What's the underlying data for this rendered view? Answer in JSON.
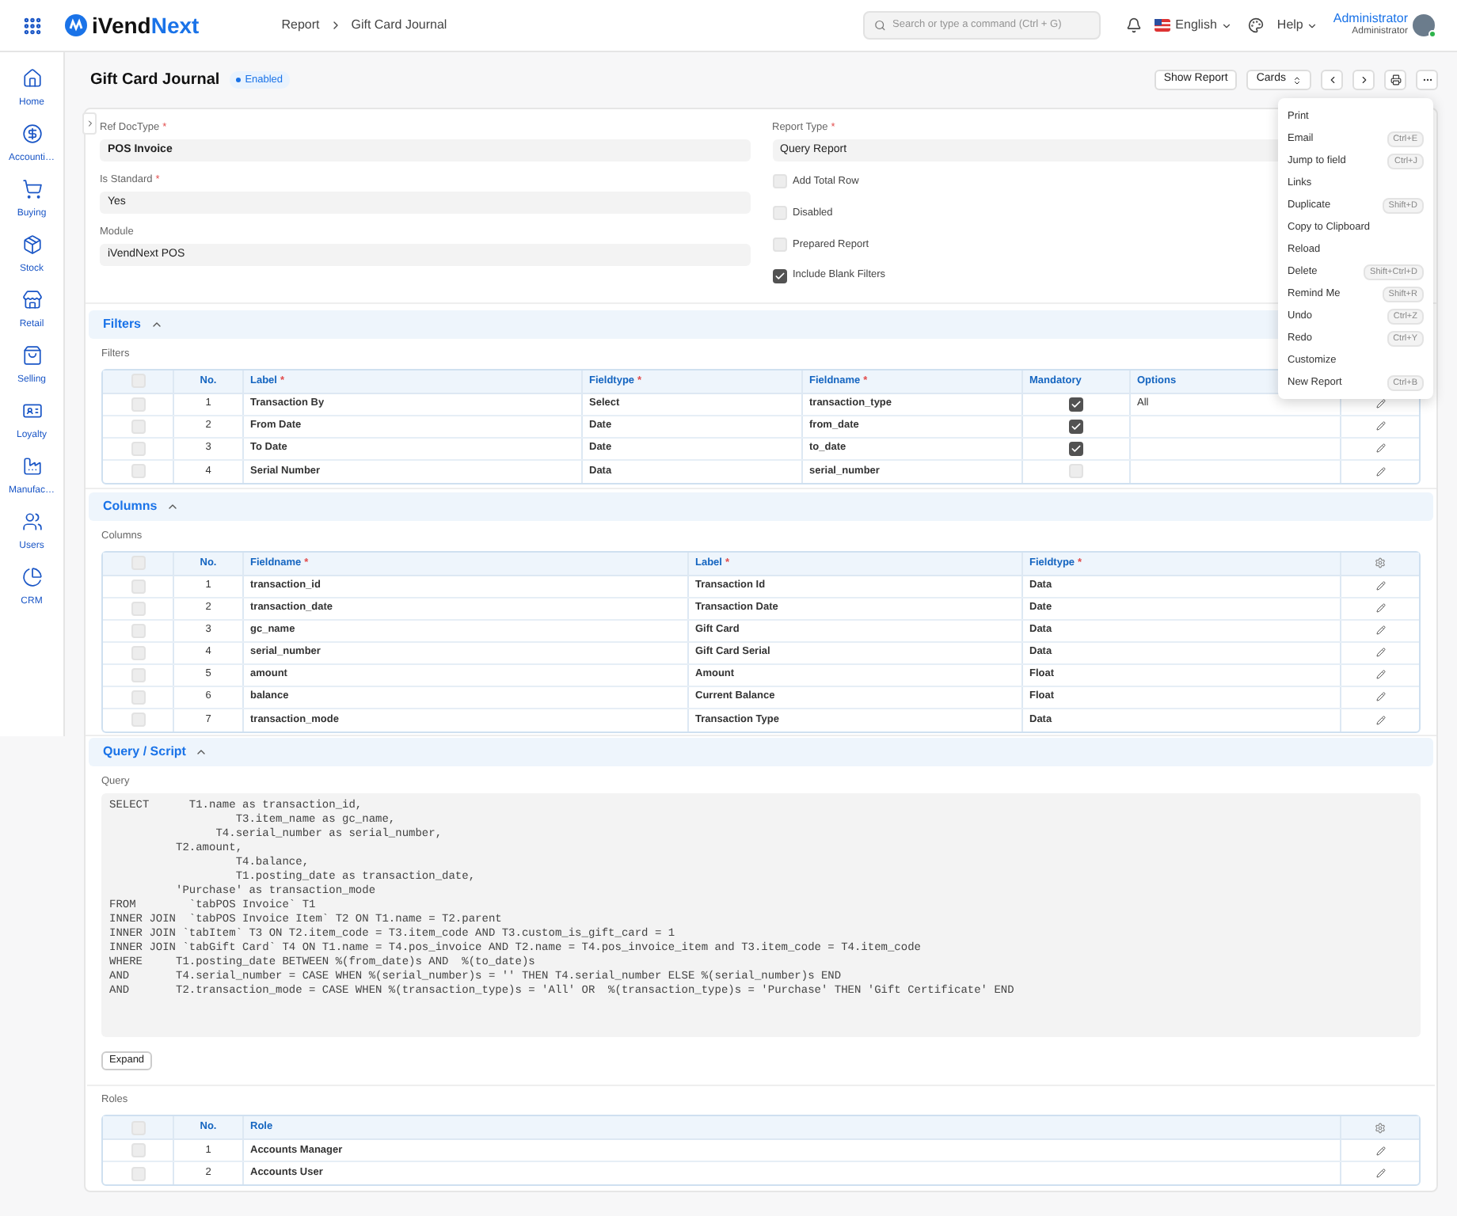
{
  "topbar": {
    "logo_a": "iVend",
    "logo_b": "Next",
    "breadcrumbs": [
      "Report",
      "Gift Card Journal"
    ],
    "search": {
      "placeholder": "Search or type a command (Ctrl + G)"
    },
    "language": "English",
    "help": "Help",
    "user": {
      "name": "Administrator",
      "role": "Administrator"
    }
  },
  "sidebar": {
    "items": [
      {
        "kind": "home",
        "label": "Home"
      },
      {
        "kind": "accounting",
        "label": "Accounti…"
      },
      {
        "kind": "buying",
        "label": "Buying"
      },
      {
        "kind": "stock",
        "label": "Stock"
      },
      {
        "kind": "retail",
        "label": "Retail"
      },
      {
        "kind": "selling",
        "label": "Selling"
      },
      {
        "kind": "loyalty",
        "label": "Loyalty"
      },
      {
        "kind": "manufacturing",
        "label": "Manufac…"
      },
      {
        "kind": "users",
        "label": "Users"
      },
      {
        "kind": "crm",
        "label": "CRM"
      }
    ]
  },
  "page": {
    "title": "Gift Card Journal",
    "status": "Enabled",
    "buttons": {
      "show_report": "Show Report",
      "view": "Cards"
    }
  },
  "menu": {
    "items": [
      {
        "label": "Print"
      },
      {
        "label": "Email",
        "shortcut": "Ctrl+E"
      },
      {
        "label": "Jump to field",
        "shortcut": "Ctrl+J"
      },
      {
        "label": "Links"
      },
      {
        "label": "Duplicate",
        "shortcut": "Shift+D"
      },
      {
        "label": "Copy to Clipboard"
      },
      {
        "label": "Reload"
      },
      {
        "label": "Delete",
        "shortcut": "Shift+Ctrl+D"
      },
      {
        "label": "Remind Me",
        "shortcut": "Shift+R"
      },
      {
        "label": "Undo",
        "shortcut": "Ctrl+Z"
      },
      {
        "label": "Redo",
        "shortcut": "Ctrl+Y"
      },
      {
        "label": "Customize"
      },
      {
        "label": "New Report",
        "shortcut": "Ctrl+B"
      }
    ]
  },
  "form": {
    "left_fields": [
      {
        "label": "Ref DocType",
        "required_mark": "*",
        "value": "POS Invoice",
        "bold": true
      },
      {
        "label": "Is Standard",
        "required_mark": "*",
        "value": "Yes",
        "bold": false
      },
      {
        "label": "Module",
        "value": "iVendNext POS",
        "bold": false
      }
    ],
    "report_type": {
      "label": "Report Type",
      "required_mark": "*",
      "value": "Query Report"
    },
    "checkboxes": [
      {
        "label": "Add Total Row",
        "checked": false
      },
      {
        "label": "Disabled",
        "checked": false
      },
      {
        "label": "Prepared Report",
        "checked": false
      },
      {
        "label": "Include Blank Filters",
        "checked": true
      }
    ]
  },
  "filters": {
    "title": "Filters",
    "expanded": true,
    "table_label": "Filters",
    "all_selected": false,
    "columns": [
      {
        "label": "No."
      },
      {
        "label": "Label",
        "required_mark": "*"
      },
      {
        "label": "Fieldtype",
        "required_mark": "*"
      },
      {
        "label": "Fieldname",
        "required_mark": "*"
      },
      {
        "label": "Mandatory"
      },
      {
        "label": "Options"
      }
    ],
    "rows": [
      {
        "selected": false,
        "no": "1",
        "label": "Transaction By",
        "fieldtype": "Select",
        "fieldname": "transaction_type",
        "mandatory": true,
        "options": "All"
      },
      {
        "selected": false,
        "no": "2",
        "label": "From Date",
        "fieldtype": "Date",
        "fieldname": "from_date",
        "mandatory": true
      },
      {
        "selected": false,
        "no": "3",
        "label": "To Date",
        "fieldtype": "Date",
        "fieldname": "to_date",
        "mandatory": true
      },
      {
        "selected": false,
        "no": "4",
        "label": "Serial Number",
        "fieldtype": "Data",
        "fieldname": "serial_number",
        "mandatory": false
      }
    ]
  },
  "columns": {
    "title": "Columns",
    "expanded": true,
    "table_label": "Columns",
    "all_selected": false,
    "columns": [
      {
        "label": "No."
      },
      {
        "label": "Fieldname",
        "required_mark": "*"
      },
      {
        "label": "Label",
        "required_mark": "*"
      },
      {
        "label": "Fieldtype",
        "required_mark": "*"
      }
    ],
    "rows": [
      {
        "selected": false,
        "no": "1",
        "fieldname": "transaction_id",
        "label": "Transaction Id",
        "fieldtype": "Data"
      },
      {
        "selected": false,
        "no": "2",
        "fieldname": "transaction_date",
        "label": "Transaction Date",
        "fieldtype": "Date"
      },
      {
        "selected": false,
        "no": "3",
        "fieldname": "gc_name",
        "label": "Gift Card",
        "fieldtype": "Data"
      },
      {
        "selected": false,
        "no": "4",
        "fieldname": "serial_number",
        "label": "Gift Card Serial",
        "fieldtype": "Data"
      },
      {
        "selected": false,
        "no": "5",
        "fieldname": "amount",
        "label": "Amount",
        "fieldtype": "Float"
      },
      {
        "selected": false,
        "no": "6",
        "fieldname": "balance",
        "label": "Current Balance",
        "fieldtype": "Float"
      },
      {
        "selected": false,
        "no": "7",
        "fieldname": "transaction_mode",
        "label": "Transaction Type",
        "fieldtype": "Data"
      }
    ]
  },
  "query": {
    "title": "Query / Script",
    "label": "Query",
    "expand_button": "Expand",
    "lines": [
      "SELECT      T1.name as transaction_id,",
      "                   T3.item_name as gc_name,",
      "                T4.serial_number as serial_number,",
      "          T2.amount,",
      "                   T4.balance,",
      "                   T1.posting_date as transaction_date,",
      "          'Purchase' as transaction_mode",
      "FROM        `tabPOS Invoice` T1",
      "INNER JOIN  `tabPOS Invoice Item` T2 ON T1.name = T2.parent",
      "INNER JOIN `tabItem` T3 ON T2.item_code = T3.item_code AND T3.custom_is_gift_card = 1",
      "INNER JOIN `tabGift Card` T4 ON T1.name = T4.pos_invoice AND T2.name = T4.pos_invoice_item and T3.item_code = T4.item_code",
      "WHERE     T1.posting_date BETWEEN %(from_date)s AND  %(to_date)s",
      "AND       T4.serial_number = CASE WHEN %(serial_number)s = '' THEN T4.serial_number ELSE %(serial_number)s END",
      "AND       T2.transaction_mode = CASE WHEN %(transaction_type)s = 'All' OR  %(transaction_type)s = 'Purchase' THEN 'Gift Certificate' END"
    ]
  },
  "roles": {
    "table_label": "Roles",
    "all_selected": false,
    "columns": [
      {
        "label": "No."
      },
      {
        "label": "Role"
      }
    ],
    "rows": [
      {
        "selected": false,
        "no": "1",
        "role": "Accounts Manager"
      },
      {
        "selected": false,
        "no": "2",
        "role": "Accounts User"
      }
    ]
  }
}
